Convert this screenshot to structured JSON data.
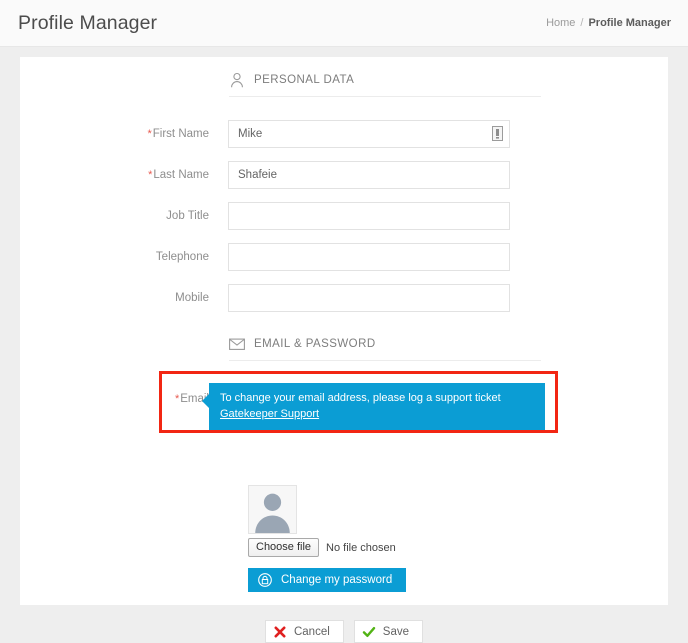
{
  "header": {
    "title": "Profile Manager",
    "breadcrumb": {
      "home": "Home",
      "separator": "/",
      "current": "Profile Manager"
    }
  },
  "sections": {
    "personal": {
      "title": "PERSONAL DATA",
      "icon": "user-icon"
    },
    "email_password": {
      "title": "EMAIL & PASSWORD",
      "icon": "envelope-icon"
    }
  },
  "form": {
    "fields": [
      {
        "label": "First Name",
        "required": true,
        "value": "Mike",
        "placeholder": "",
        "name": "first-name"
      },
      {
        "label": "Last Name",
        "required": true,
        "value": "Shafeie",
        "placeholder": "",
        "name": "last-name"
      },
      {
        "label": "Job Title",
        "required": false,
        "value": "",
        "placeholder": "",
        "name": "job-title"
      },
      {
        "label": "Telephone",
        "required": false,
        "value": "",
        "placeholder": "",
        "name": "telephone"
      },
      {
        "label": "Mobile",
        "required": false,
        "value": "",
        "placeholder": "",
        "name": "mobile"
      }
    ],
    "email": {
      "label": "Email",
      "required": true,
      "value": "",
      "placeholder": ""
    },
    "required_marker": "*"
  },
  "tooltip": {
    "message": "To change your email address, please log a support ticket",
    "link_text": "Gatekeeper Support",
    "background": "#0b9dd4",
    "text_color": "#ffffff"
  },
  "highlight": {
    "color": "#f22613"
  },
  "avatar": {
    "alt": "profile-photo-placeholder"
  },
  "file_upload": {
    "button_label": "Choose file",
    "status_text": "No file chosen"
  },
  "password_button": {
    "label": "Change my password",
    "icon": "lock-icon",
    "color": "#0b9dd4"
  },
  "footer": {
    "cancel": {
      "label": "Cancel",
      "icon": "cross-icon",
      "color": "#e02020"
    },
    "save": {
      "label": "Save",
      "icon": "check-icon",
      "color": "#52b315"
    }
  }
}
